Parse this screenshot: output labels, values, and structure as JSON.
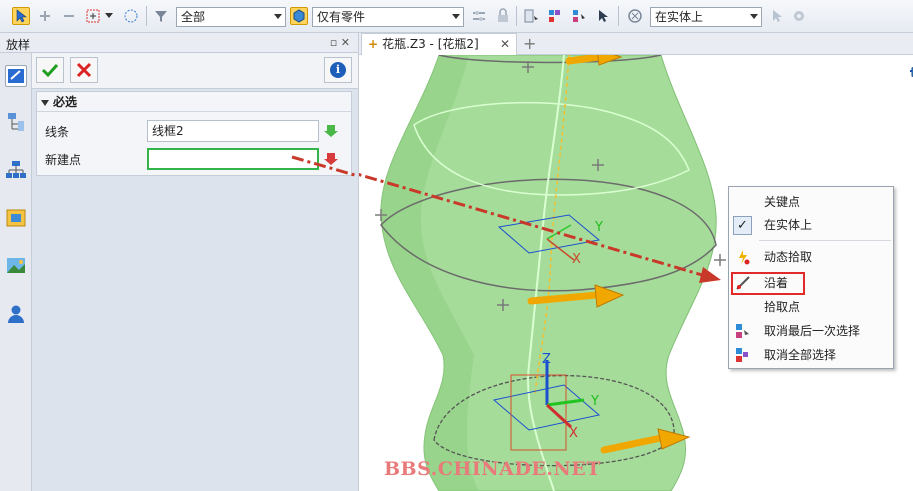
{
  "toolbar": {
    "filter_select": "全部",
    "scope_select": "仅有零件",
    "pick_select": "在实体上"
  },
  "panel": {
    "title": "放样",
    "header_icons": "▫ ✕",
    "section_title": "必选",
    "rows": [
      {
        "label": "线条",
        "value": "线框2"
      },
      {
        "label": "新建点",
        "value": ""
      }
    ]
  },
  "document": {
    "tab_label": "花瓶.Z3 - [花瓶2]",
    "tab_close": "✕",
    "add_tab": "+"
  },
  "viewport": {
    "axis_labels": {
      "x": "X",
      "y": "Y",
      "z": "Z"
    }
  },
  "context_menu": {
    "items": [
      {
        "label": "关键点",
        "icon": "none"
      },
      {
        "label": "在实体上",
        "icon": "check",
        "checked": true
      },
      {
        "label": "动态拾取",
        "icon": "dynamic-pick-icon"
      },
      {
        "label": "沿着",
        "icon": "along-curve-icon",
        "highlighted": true
      },
      {
        "label": "拾取点",
        "icon": "none"
      },
      {
        "label": "取消最后一次选择",
        "icon": "undo-selection-icon"
      },
      {
        "label": "取消全部选择",
        "icon": "clear-selection-icon"
      }
    ]
  },
  "watermark": "BBS.CHINADE.NET",
  "colors": {
    "accent": "#ffd45e",
    "surface_green": "#a6dc9a",
    "highlight_red": "#e12a2a",
    "focus_green": "#33b44a"
  }
}
